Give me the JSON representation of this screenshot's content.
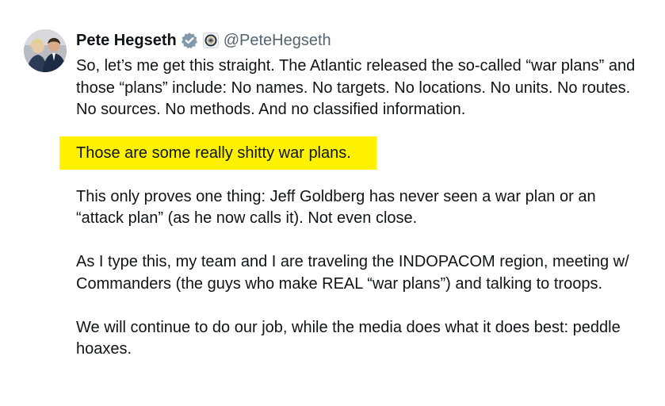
{
  "author": {
    "display_name": "Pete Hegseth",
    "handle": "@PeteHegseth",
    "verified_icon": "verified-badge-icon",
    "affiliation_icon": "dod-seal-icon"
  },
  "post": {
    "para1": "So, let’s me get this straight. The Atlantic released the so-called “war plans” and those “plans” include: No names. No targets. No locations. No units. No routes. No sources. No methods. And no classified information.",
    "para2": "Those are some really shitty war plans.",
    "para3": "This only proves one thing: Jeff Goldberg has never seen a war plan or an “attack plan” (as he now calls it). Not even close.",
    "para4": "As I type this, my team and I are traveling the INDOPACOM region, meeting w/ Commanders (the guys who make REAL “war plans”) and talking to troops.",
    "para5": "We will continue to do our job, while the media does what it does best: peddle hoaxes."
  },
  "colors": {
    "highlight": "#fff200",
    "text": "#0f1419",
    "handle": "#536471",
    "verified": "#829aab"
  }
}
